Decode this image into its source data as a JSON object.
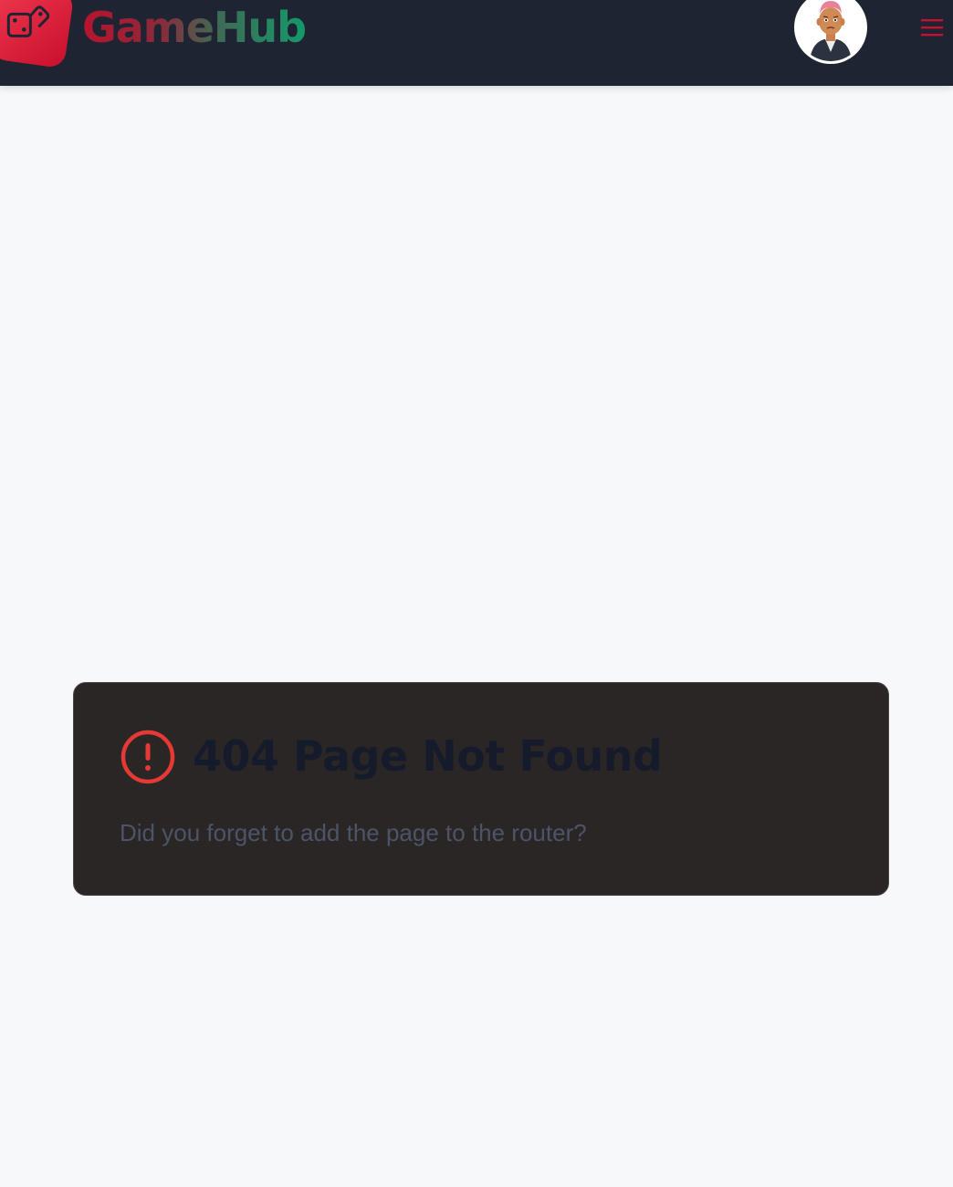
{
  "header": {
    "brand": "GameHub",
    "logo_icon": "dice-icon",
    "avatar_icon": "user-avatar",
    "menu_icon": "hamburger-menu-icon"
  },
  "error": {
    "icon": "alert-circle-icon",
    "title": "404 Page Not Found",
    "message": "Did you forget to add the page to the router?"
  },
  "colors": {
    "header_bg": "#1f2433",
    "page_bg": "#f7f8fa",
    "brand_red": "#c8102e",
    "brand_green": "#139a6a",
    "card_bg": "#2a2625",
    "error_red": "#e53935",
    "title_color": "#161b2c",
    "message_color": "#4d5467"
  }
}
